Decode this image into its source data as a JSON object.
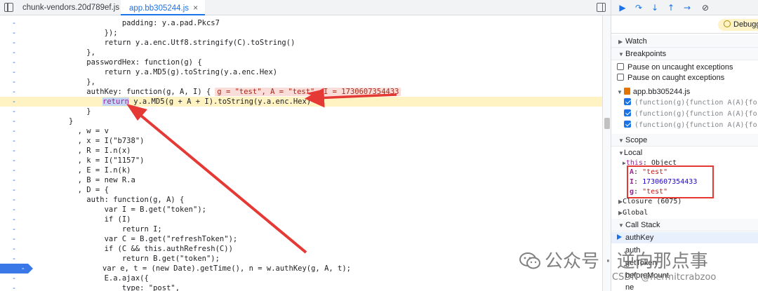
{
  "tabs": [
    {
      "label": "chunk-vendors.20d789ef.js",
      "active": false
    },
    {
      "label": "app.bb305244.js",
      "active": true,
      "close": "×"
    }
  ],
  "editor": {
    "gutter_mark": "-",
    "lines": [
      {
        "text": "            padding: y.a.pad.Pkcs7"
      },
      {
        "text": "        });"
      },
      {
        "text": "        return y.a.enc.Utf8.stringify(C).toString()"
      },
      {
        "text": "    },"
      },
      {
        "text": "    passwordHex: function(g) {"
      },
      {
        "text": "        return y.a.MD5(g).toString(y.a.enc.Hex)"
      },
      {
        "text": "    },"
      },
      {
        "text": "    authKey: function(g, A, I) {",
        "inline": "g = \"test\", A = \"test\", I = 1730607354433"
      },
      {
        "highlight": true,
        "sel": "return",
        "text": " y.a.MD5(g + A + I).toString(y.a.enc.Hex)"
      },
      {
        "text": "    }"
      },
      {
        "text": "}"
      },
      {
        "text": "  , w = v"
      },
      {
        "text": "  , x = I(\"b738\")"
      },
      {
        "text": "  , R = I.n(x)"
      },
      {
        "text": "  , k = I(\"1157\")"
      },
      {
        "text": "  , E = I.n(k)"
      },
      {
        "text": "  , B = new R.a"
      },
      {
        "text": "  , D = {"
      },
      {
        "text": "    auth: function(g, A) {"
      },
      {
        "text": "        var I = B.get(\"token\");"
      },
      {
        "text": "        if (I)"
      },
      {
        "text": "            return I;"
      },
      {
        "text": "        var C = B.get(\"refreshToken\");"
      },
      {
        "text": "        if (C && this.authRefresh(C))"
      },
      {
        "text": "            return B.get(\"token\");"
      },
      {
        "breakpoint": true,
        "bp_label": "-",
        "text": "var e, t = (new Date).getTime(), n = w.authKey(g, A, t);"
      },
      {
        "text": "        E.a.ajax({"
      },
      {
        "text": "            type: \"post\","
      },
      {
        "text": "            xhrFields: {"
      }
    ]
  },
  "debugger": {
    "paused_label": "Debugg",
    "sections": {
      "watch": "Watch",
      "breakpoints": "Breakpoints",
      "scope": "Scope",
      "call_stack": "Call Stack"
    },
    "pause_uncaught": "Pause on uncaught exceptions",
    "pause_caught": "Pause on caught exceptions",
    "bp_file": "app.bb305244.js",
    "bp_items": [
      "(function(g){function A(A){for",
      "(function(g){function A(A){for",
      "(function(g){function A(A){for"
    ],
    "scope": {
      "local": "Local",
      "this_key": "this",
      "this_val": "Object",
      "vars": [
        {
          "key": "A",
          "val": "\"test\"",
          "type": "str"
        },
        {
          "key": "I",
          "val": "1730607354433",
          "type": "num"
        },
        {
          "key": "g",
          "val": "\"test\"",
          "type": "str"
        }
      ],
      "closure": "Closure (6075)",
      "global": "Global"
    },
    "call_stack": [
      "authKey",
      "auth",
      "getToken",
      "beforeMount",
      "ne"
    ]
  },
  "watermark": {
    "text": "公众号 · 逆向那点事",
    "credit": "CSDN @hermitcrabzoo"
  }
}
